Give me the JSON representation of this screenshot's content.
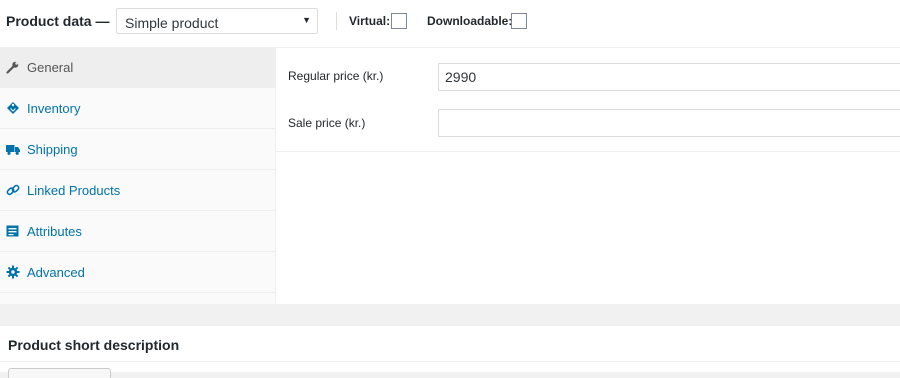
{
  "header": {
    "title": "Product data —",
    "product_type": "Simple product",
    "virtual_label": "Virtual:",
    "downloadable_label": "Downloadable:"
  },
  "tabs": [
    {
      "label": "General",
      "icon": "wrench-icon",
      "active": true
    },
    {
      "label": "Inventory",
      "icon": "tag-icon",
      "active": false
    },
    {
      "label": "Shipping",
      "icon": "truck-icon",
      "active": false
    },
    {
      "label": "Linked Products",
      "icon": "link-icon",
      "active": false
    },
    {
      "label": "Attributes",
      "icon": "list-icon",
      "active": false
    },
    {
      "label": "Advanced",
      "icon": "gear-icon",
      "active": false
    }
  ],
  "fields": {
    "regular_price_label": "Regular price (kr.)",
    "regular_price_value": "2990",
    "sale_price_label": "Sale price (kr.)",
    "sale_price_value": ""
  },
  "short_description": {
    "title": "Product short description"
  },
  "colors": {
    "link": "#0073aa",
    "active_tab": "#eeeeee",
    "icon_active": "#555555"
  }
}
